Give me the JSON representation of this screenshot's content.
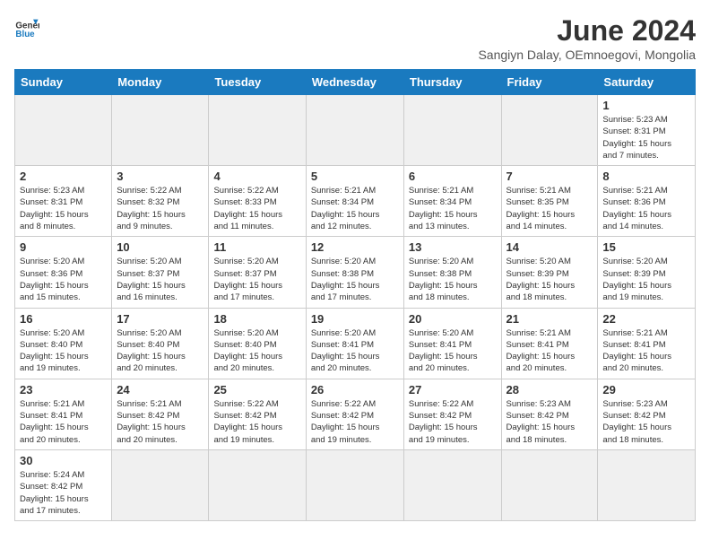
{
  "header": {
    "logo_line1": "General",
    "logo_line2": "Blue",
    "title": "June 2024",
    "subtitle": "Sangiyn Dalay, OEmnoegovi, Mongolia"
  },
  "weekdays": [
    "Sunday",
    "Monday",
    "Tuesday",
    "Wednesday",
    "Thursday",
    "Friday",
    "Saturday"
  ],
  "weeks": [
    [
      {
        "day": "",
        "info": ""
      },
      {
        "day": "",
        "info": ""
      },
      {
        "day": "",
        "info": ""
      },
      {
        "day": "",
        "info": ""
      },
      {
        "day": "",
        "info": ""
      },
      {
        "day": "",
        "info": ""
      },
      {
        "day": "1",
        "info": "Sunrise: 5:23 AM\nSunset: 8:31 PM\nDaylight: 15 hours\nand 7 minutes."
      }
    ],
    [
      {
        "day": "2",
        "info": "Sunrise: 5:23 AM\nSunset: 8:31 PM\nDaylight: 15 hours\nand 8 minutes."
      },
      {
        "day": "3",
        "info": "Sunrise: 5:22 AM\nSunset: 8:32 PM\nDaylight: 15 hours\nand 9 minutes."
      },
      {
        "day": "4",
        "info": "Sunrise: 5:22 AM\nSunset: 8:33 PM\nDaylight: 15 hours\nand 11 minutes."
      },
      {
        "day": "5",
        "info": "Sunrise: 5:21 AM\nSunset: 8:34 PM\nDaylight: 15 hours\nand 12 minutes."
      },
      {
        "day": "6",
        "info": "Sunrise: 5:21 AM\nSunset: 8:34 PM\nDaylight: 15 hours\nand 13 minutes."
      },
      {
        "day": "7",
        "info": "Sunrise: 5:21 AM\nSunset: 8:35 PM\nDaylight: 15 hours\nand 14 minutes."
      },
      {
        "day": "8",
        "info": "Sunrise: 5:21 AM\nSunset: 8:36 PM\nDaylight: 15 hours\nand 14 minutes."
      }
    ],
    [
      {
        "day": "9",
        "info": "Sunrise: 5:20 AM\nSunset: 8:36 PM\nDaylight: 15 hours\nand 15 minutes."
      },
      {
        "day": "10",
        "info": "Sunrise: 5:20 AM\nSunset: 8:37 PM\nDaylight: 15 hours\nand 16 minutes."
      },
      {
        "day": "11",
        "info": "Sunrise: 5:20 AM\nSunset: 8:37 PM\nDaylight: 15 hours\nand 17 minutes."
      },
      {
        "day": "12",
        "info": "Sunrise: 5:20 AM\nSunset: 8:38 PM\nDaylight: 15 hours\nand 17 minutes."
      },
      {
        "day": "13",
        "info": "Sunrise: 5:20 AM\nSunset: 8:38 PM\nDaylight: 15 hours\nand 18 minutes."
      },
      {
        "day": "14",
        "info": "Sunrise: 5:20 AM\nSunset: 8:39 PM\nDaylight: 15 hours\nand 18 minutes."
      },
      {
        "day": "15",
        "info": "Sunrise: 5:20 AM\nSunset: 8:39 PM\nDaylight: 15 hours\nand 19 minutes."
      }
    ],
    [
      {
        "day": "16",
        "info": "Sunrise: 5:20 AM\nSunset: 8:40 PM\nDaylight: 15 hours\nand 19 minutes."
      },
      {
        "day": "17",
        "info": "Sunrise: 5:20 AM\nSunset: 8:40 PM\nDaylight: 15 hours\nand 20 minutes."
      },
      {
        "day": "18",
        "info": "Sunrise: 5:20 AM\nSunset: 8:40 PM\nDaylight: 15 hours\nand 20 minutes."
      },
      {
        "day": "19",
        "info": "Sunrise: 5:20 AM\nSunset: 8:41 PM\nDaylight: 15 hours\nand 20 minutes."
      },
      {
        "day": "20",
        "info": "Sunrise: 5:20 AM\nSunset: 8:41 PM\nDaylight: 15 hours\nand 20 minutes."
      },
      {
        "day": "21",
        "info": "Sunrise: 5:21 AM\nSunset: 8:41 PM\nDaylight: 15 hours\nand 20 minutes."
      },
      {
        "day": "22",
        "info": "Sunrise: 5:21 AM\nSunset: 8:41 PM\nDaylight: 15 hours\nand 20 minutes."
      }
    ],
    [
      {
        "day": "23",
        "info": "Sunrise: 5:21 AM\nSunset: 8:41 PM\nDaylight: 15 hours\nand 20 minutes."
      },
      {
        "day": "24",
        "info": "Sunrise: 5:21 AM\nSunset: 8:42 PM\nDaylight: 15 hours\nand 20 minutes."
      },
      {
        "day": "25",
        "info": "Sunrise: 5:22 AM\nSunset: 8:42 PM\nDaylight: 15 hours\nand 19 minutes."
      },
      {
        "day": "26",
        "info": "Sunrise: 5:22 AM\nSunset: 8:42 PM\nDaylight: 15 hours\nand 19 minutes."
      },
      {
        "day": "27",
        "info": "Sunrise: 5:22 AM\nSunset: 8:42 PM\nDaylight: 15 hours\nand 19 minutes."
      },
      {
        "day": "28",
        "info": "Sunrise: 5:23 AM\nSunset: 8:42 PM\nDaylight: 15 hours\nand 18 minutes."
      },
      {
        "day": "29",
        "info": "Sunrise: 5:23 AM\nSunset: 8:42 PM\nDaylight: 15 hours\nand 18 minutes."
      }
    ],
    [
      {
        "day": "30",
        "info": "Sunrise: 5:24 AM\nSunset: 8:42 PM\nDaylight: 15 hours\nand 17 minutes."
      },
      {
        "day": "",
        "info": ""
      },
      {
        "day": "",
        "info": ""
      },
      {
        "day": "",
        "info": ""
      },
      {
        "day": "",
        "info": ""
      },
      {
        "day": "",
        "info": ""
      },
      {
        "day": "",
        "info": ""
      }
    ]
  ]
}
